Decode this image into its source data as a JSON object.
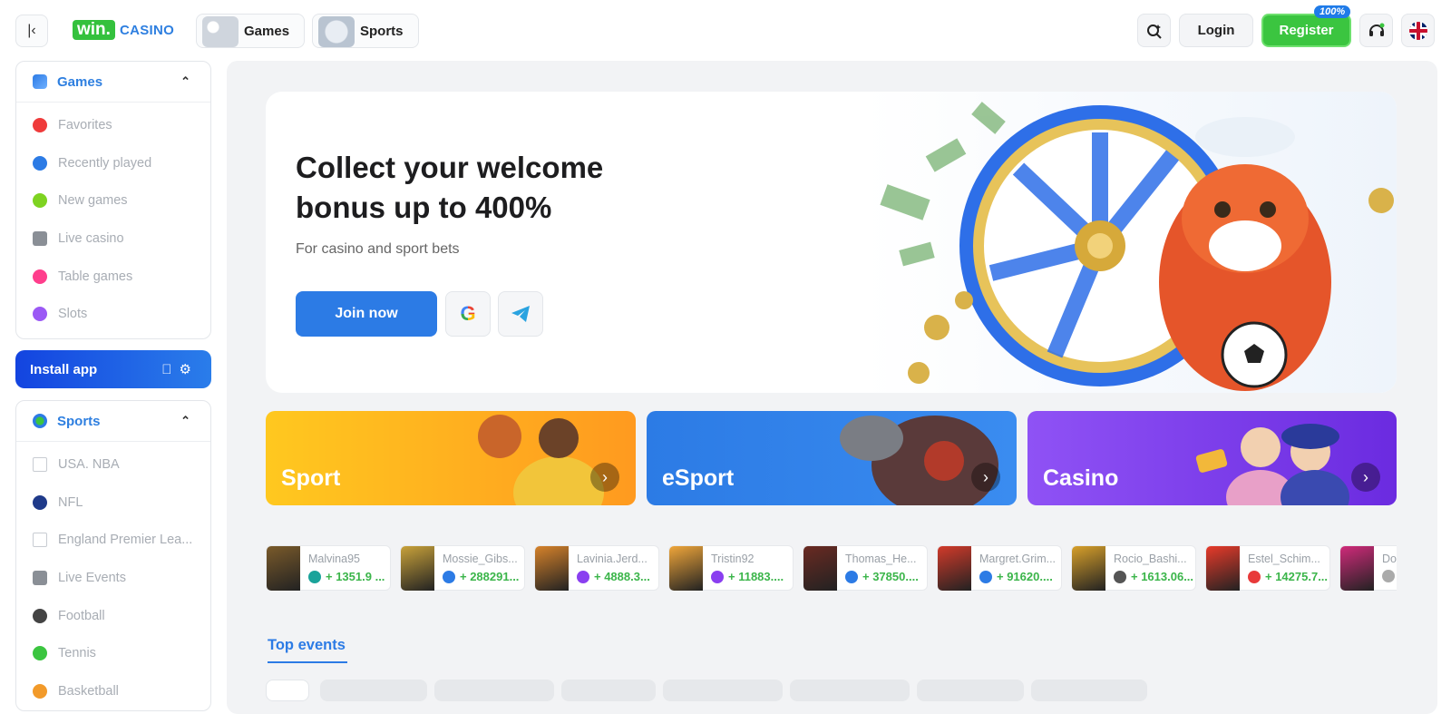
{
  "header": {
    "logo_win": "win.",
    "logo_casino": "CASINO",
    "nav_games": "Games",
    "nav_sports": "Sports",
    "login": "Login",
    "register": "Register",
    "register_badge": "100%"
  },
  "sidebar": {
    "games_title": "Games",
    "games_items": [
      {
        "label": "Favorites",
        "icon": "heart-icon",
        "color": "#ef3b3b"
      },
      {
        "label": "Recently played",
        "icon": "history-icon",
        "color": "#2c7be5"
      },
      {
        "label": "New games",
        "icon": "new-icon",
        "color": "#7ed321"
      },
      {
        "label": "Live casino",
        "icon": "live-icon",
        "color": "#8a8f96"
      },
      {
        "label": "Table games",
        "icon": "cards-icon",
        "color": "#ff3e8c"
      },
      {
        "label": "Slots",
        "icon": "slots-icon",
        "color": "#9b59f5"
      }
    ],
    "install_app": "Install app",
    "sports_title": "Sports",
    "sports_items": [
      {
        "label": "USA. NBA",
        "icon": "nba-icon"
      },
      {
        "label": "NFL",
        "icon": "nfl-icon"
      },
      {
        "label": "England Premier Lea...",
        "icon": "epl-icon"
      },
      {
        "label": "Live Events",
        "icon": "live-icon"
      },
      {
        "label": "Football",
        "icon": "football-icon"
      },
      {
        "label": "Tennis",
        "icon": "tennis-icon"
      },
      {
        "label": "Basketball",
        "icon": "basketball-icon"
      }
    ]
  },
  "hero": {
    "title": "Collect your welcome bonus up to 400%",
    "subtitle": "For casino and sport bets",
    "join": "Join now"
  },
  "categories": [
    {
      "label": "Sport"
    },
    {
      "label": "eSport"
    },
    {
      "label": "Casino"
    }
  ],
  "wins": [
    {
      "user": "Malvina95",
      "amount": "+ 1351.9 ...",
      "thumb": "#7a5a2a",
      "cur": "#1aa39a"
    },
    {
      "user": "Mossie_Gibs...",
      "amount": "+ 288291...",
      "thumb": "#c9a23a",
      "cur": "#2c7be5"
    },
    {
      "user": "Lavinia.Jerd...",
      "amount": "+ 4888.3...",
      "thumb": "#d6822a",
      "cur": "#8a3ff0"
    },
    {
      "user": "Tristin92",
      "amount": "+ 11883....",
      "thumb": "#f0a63a",
      "cur": "#8a3ff0"
    },
    {
      "user": "Thomas_He...",
      "amount": "+ 37850....",
      "thumb": "#6a2a22",
      "cur": "#2c7be5"
    },
    {
      "user": "Margret.Grim...",
      "amount": "+ 91620....",
      "thumb": "#d23a2a",
      "cur": "#2c7be5"
    },
    {
      "user": "Rocio_Bashi...",
      "amount": "+ 1613.06...",
      "thumb": "#d8a02a",
      "cur": "#555"
    },
    {
      "user": "Estel_Schim...",
      "amount": "+ 14275.7...",
      "thumb": "#e83a2a",
      "cur": "#e83a3a"
    },
    {
      "user": "Dor",
      "amount": "",
      "thumb": "#d02a7a",
      "cur": "#aaa"
    }
  ],
  "top_events": "Top events"
}
